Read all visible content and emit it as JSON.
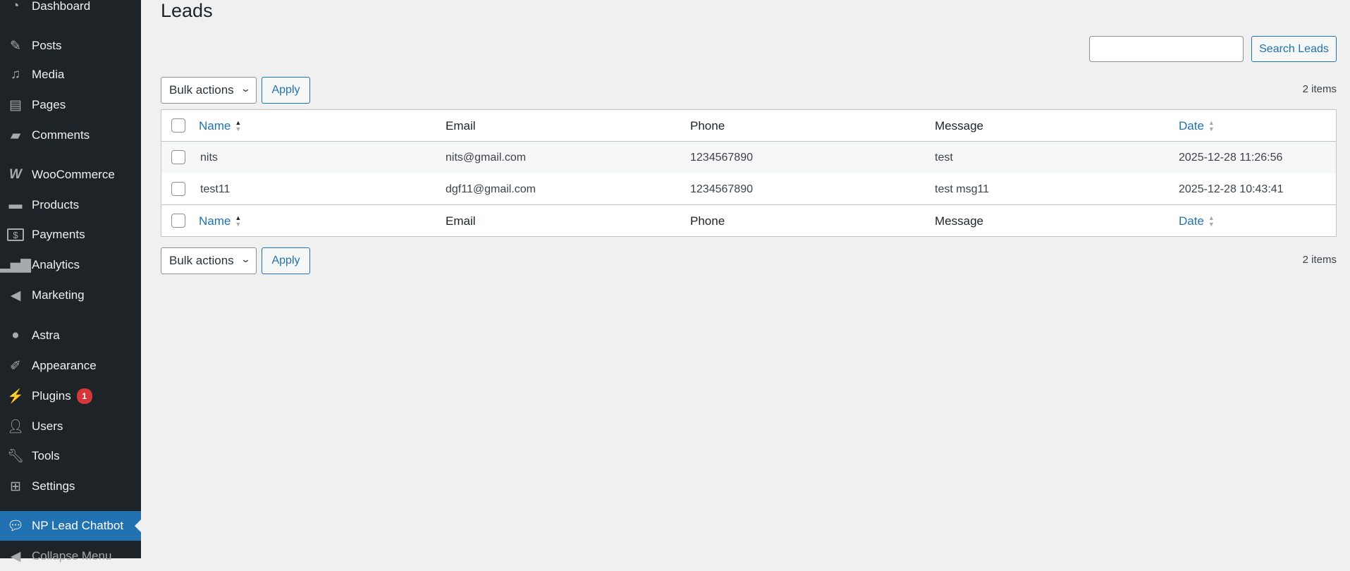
{
  "sidebar": {
    "items": [
      {
        "label": "Dashboard",
        "icon": "dashboard-icon"
      },
      {
        "label": "Posts",
        "icon": "pin-icon"
      },
      {
        "label": "Media",
        "icon": "media-icon"
      },
      {
        "label": "Pages",
        "icon": "pages-icon"
      },
      {
        "label": "Comments",
        "icon": "comment-icon"
      },
      {
        "label": "WooCommerce",
        "icon": "woocommerce-icon"
      },
      {
        "label": "Products",
        "icon": "archive-icon"
      },
      {
        "label": "Payments",
        "icon": "dollar-icon"
      },
      {
        "label": "Analytics",
        "icon": "bar-chart-icon"
      },
      {
        "label": "Marketing",
        "icon": "megaphone-icon"
      },
      {
        "label": "Astra",
        "icon": "astra-icon"
      },
      {
        "label": "Appearance",
        "icon": "paintbrush-icon"
      },
      {
        "label": "Plugins",
        "icon": "plugin-icon",
        "badge": "1"
      },
      {
        "label": "Users",
        "icon": "user-icon"
      },
      {
        "label": "Tools",
        "icon": "wrench-icon"
      },
      {
        "label": "Settings",
        "icon": "settings-icon"
      },
      {
        "label": "NP Lead Chatbot",
        "icon": "chat-icon",
        "active": true
      },
      {
        "label": "Collapse Menu",
        "icon": "collapse-icon"
      }
    ]
  },
  "page": {
    "title": "Leads",
    "search_button": "Search Leads",
    "search_value": "",
    "bulk_actions": "Bulk actions",
    "apply": "Apply",
    "items_count": "2 items"
  },
  "table": {
    "columns": [
      "Name",
      "Email",
      "Phone",
      "Message",
      "Date"
    ],
    "rows": [
      {
        "name": "nits",
        "email": "nits@gmail.com",
        "phone": "1234567890",
        "message": "test",
        "date": "2025-12-28 11:26:56"
      },
      {
        "name": "test11",
        "email": "dgf11@gmail.com",
        "phone": "1234567890",
        "message": "test msg11",
        "date": "2025-12-28 10:43:41"
      }
    ]
  }
}
